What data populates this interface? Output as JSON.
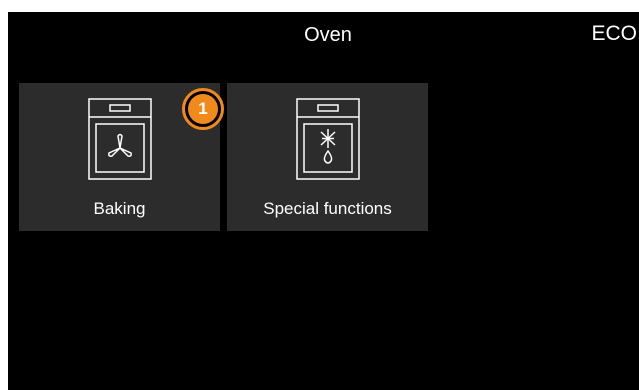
{
  "header": {
    "title": "Oven",
    "mode": "ECO"
  },
  "tiles": [
    {
      "label": "Baking",
      "icon": "oven-fan-icon",
      "badge": "1"
    },
    {
      "label": "Special functions",
      "icon": "oven-special-functions-icon"
    }
  ],
  "colors": {
    "background": "#000000",
    "tile": "#2c2c2c",
    "badge": "#f08a1c",
    "text": "#ffffff"
  }
}
